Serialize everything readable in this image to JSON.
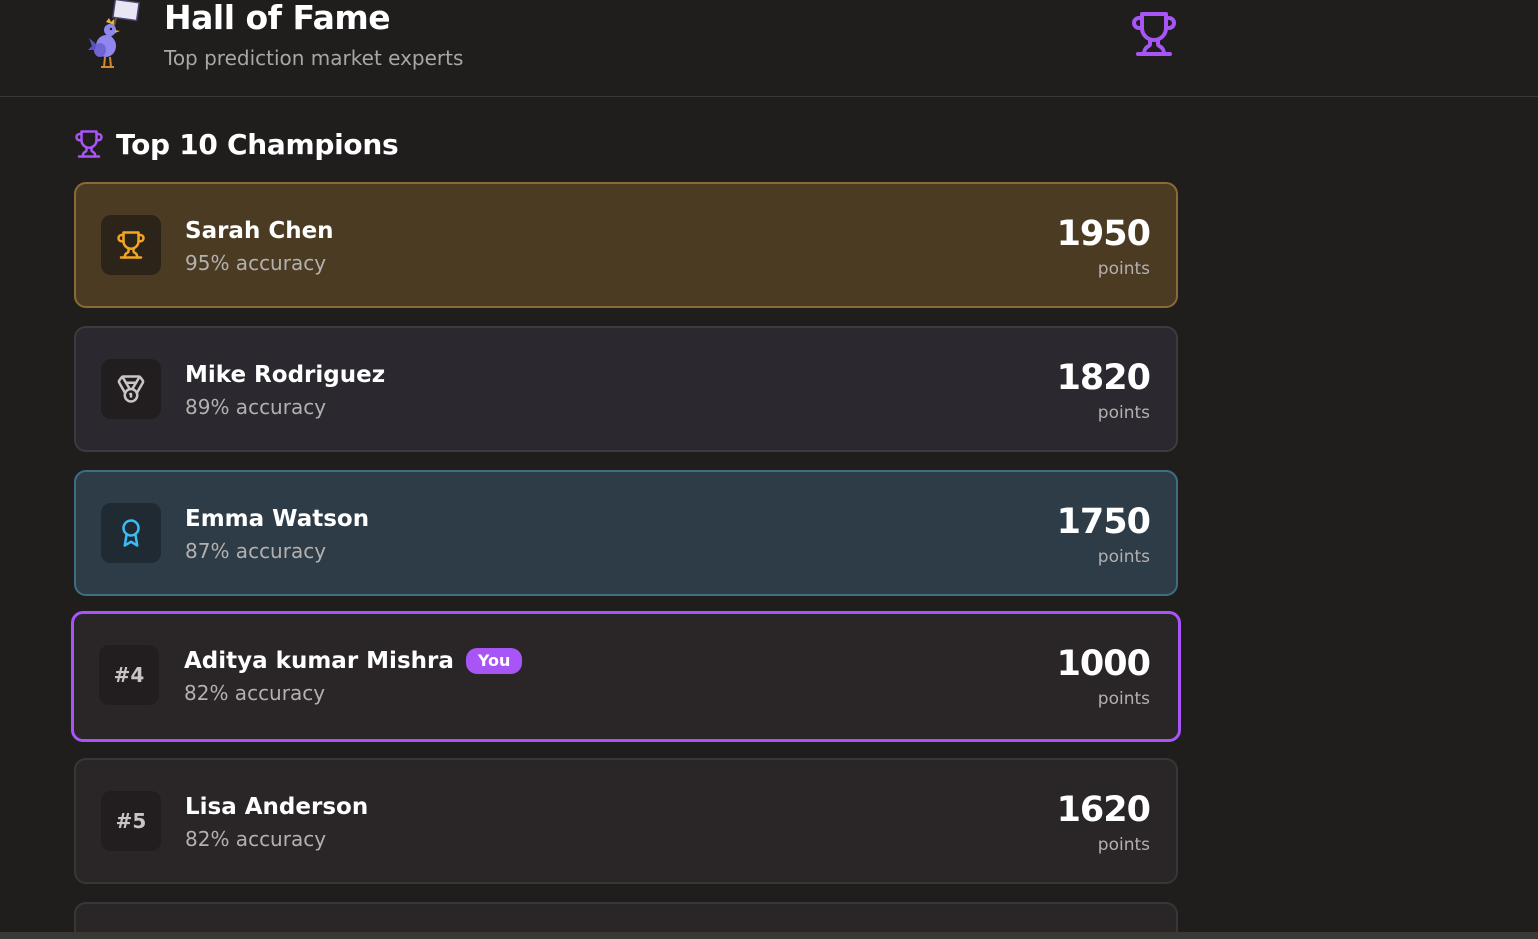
{
  "header": {
    "title": "Hall of Fame",
    "subtitle": "Top prediction market experts",
    "mascot_icon": "chicken-with-sign-icon",
    "trophy_icon": "trophy-icon"
  },
  "section": {
    "title": "Top 10 Champions",
    "icon": "trophy-icon"
  },
  "leaderboard": [
    {
      "rank": "#1",
      "rank_icon": "trophy-icon",
      "name": "Sarah Chen",
      "accuracy": "95% accuracy",
      "points": "1950",
      "points_label": "points",
      "tier": "gold"
    },
    {
      "rank": "#2",
      "rank_icon": "medal-icon",
      "name": "Mike Rodriguez",
      "accuracy": "89% accuracy",
      "points": "1820",
      "points_label": "points",
      "tier": "silver"
    },
    {
      "rank": "#3",
      "rank_icon": "award-ribbon-icon",
      "name": "Emma Watson",
      "accuracy": "87% accuracy",
      "points": "1750",
      "points_label": "points",
      "tier": "bronze"
    },
    {
      "rank": "#4",
      "name": "Aditya kumar Mishra",
      "badge": "You",
      "accuracy": "82% accuracy",
      "points": "1000",
      "points_label": "points",
      "tier": "current-user"
    },
    {
      "rank": "#5",
      "name": "Lisa Anderson",
      "accuracy": "82% accuracy",
      "points": "1620",
      "points_label": "points",
      "tier": "default"
    }
  ],
  "colors": {
    "background": "#201d1d",
    "accent_purple": "#a855f7",
    "gold": "#f5a524",
    "silver": "#c9c5c5",
    "bronze_blue": "#38bdf8"
  }
}
